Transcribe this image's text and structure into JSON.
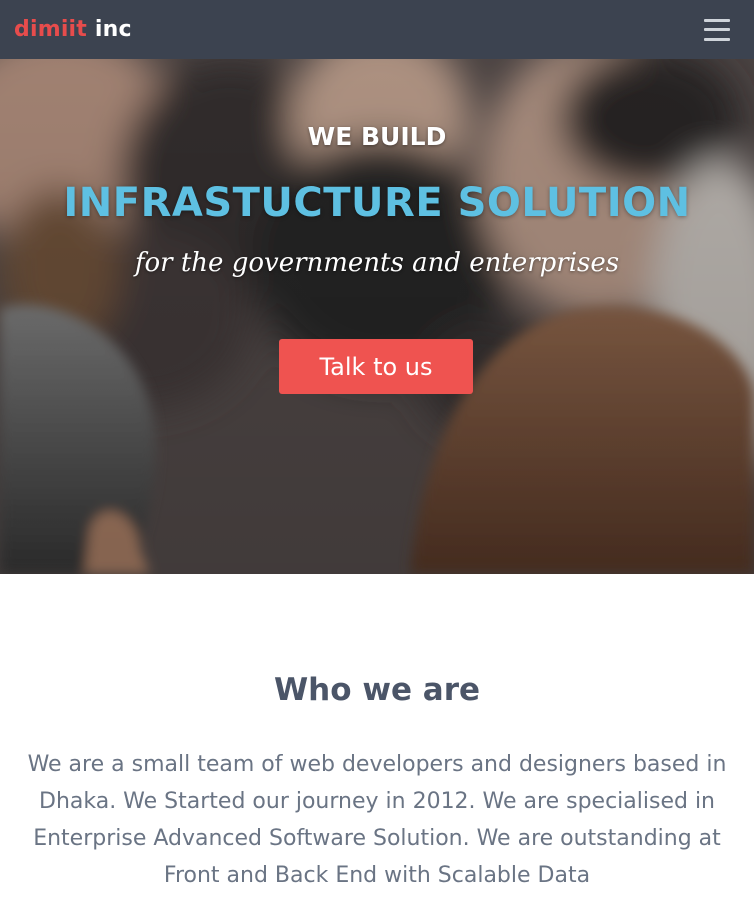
{
  "navbar": {
    "brand_part_1": "dimiit",
    "brand_part_2": " inc",
    "menu_icon": "hamburger-menu-icon"
  },
  "hero": {
    "eyebrow": "WE BUILD",
    "headline": "INFRASTUCTURE SOLUTION",
    "tagline": "for the governments and enterprises",
    "cta_label": "Talk to us"
  },
  "about": {
    "title": "Who we are",
    "body": "We are a small team of web developers and designers based in Dhaka. We Started our journey in 2012. We are specialised in Enterprise Advanced Software Solution. We are outstanding at Front and Back End with Scalable Data"
  },
  "colors": {
    "navbar_bg": "#3c4350",
    "brand_red": "#e74c4c",
    "headline_blue": "#5ec0e2",
    "cta_red": "#ef5350",
    "heading_text": "#4b5568",
    "body_text": "#6a7484"
  }
}
